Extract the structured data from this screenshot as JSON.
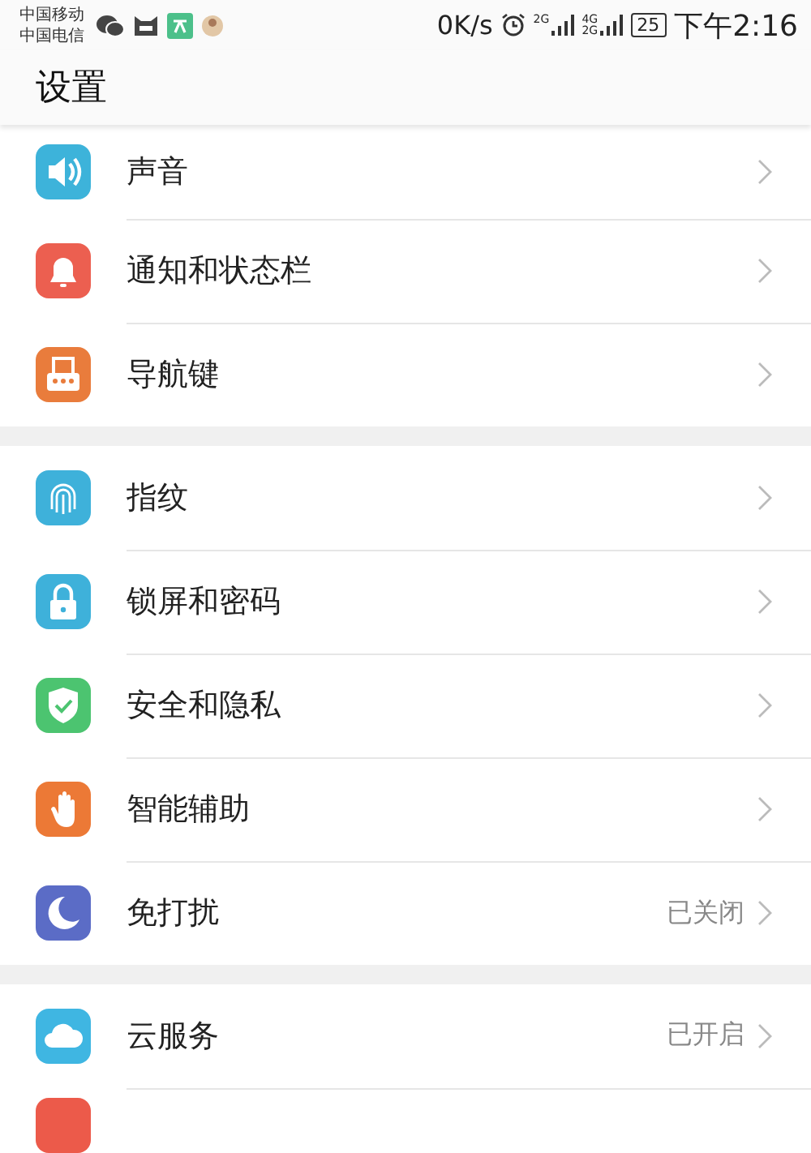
{
  "status_bar": {
    "carriers": [
      "中国移动",
      "中国电信"
    ],
    "speed": "0K/s",
    "signal_1_label": "2G",
    "signal_2_labels": [
      "4G",
      "2G"
    ],
    "battery": "25",
    "time": "下午2:16"
  },
  "title": "设置",
  "groups": [
    {
      "items": [
        {
          "label": "声音",
          "color": "#3db3da"
        },
        {
          "label": "通知和状态栏",
          "color": "#ec5f50"
        },
        {
          "label": "导航键",
          "color": "#e97c3c"
        }
      ]
    },
    {
      "items": [
        {
          "label": "指纹",
          "color": "#3eb1da"
        },
        {
          "label": "锁屏和密码",
          "color": "#3eb1da"
        },
        {
          "label": "安全和隐私",
          "color": "#4cc470"
        },
        {
          "label": "智能辅助",
          "color": "#ec7936"
        },
        {
          "label": "免打扰",
          "color": "#5b6cc6",
          "status": "已关闭"
        }
      ]
    },
    {
      "items": [
        {
          "label": "云服务",
          "color": "#3fb6e2",
          "status": "已开启"
        },
        {
          "color": "#ec5a4a"
        }
      ]
    }
  ]
}
